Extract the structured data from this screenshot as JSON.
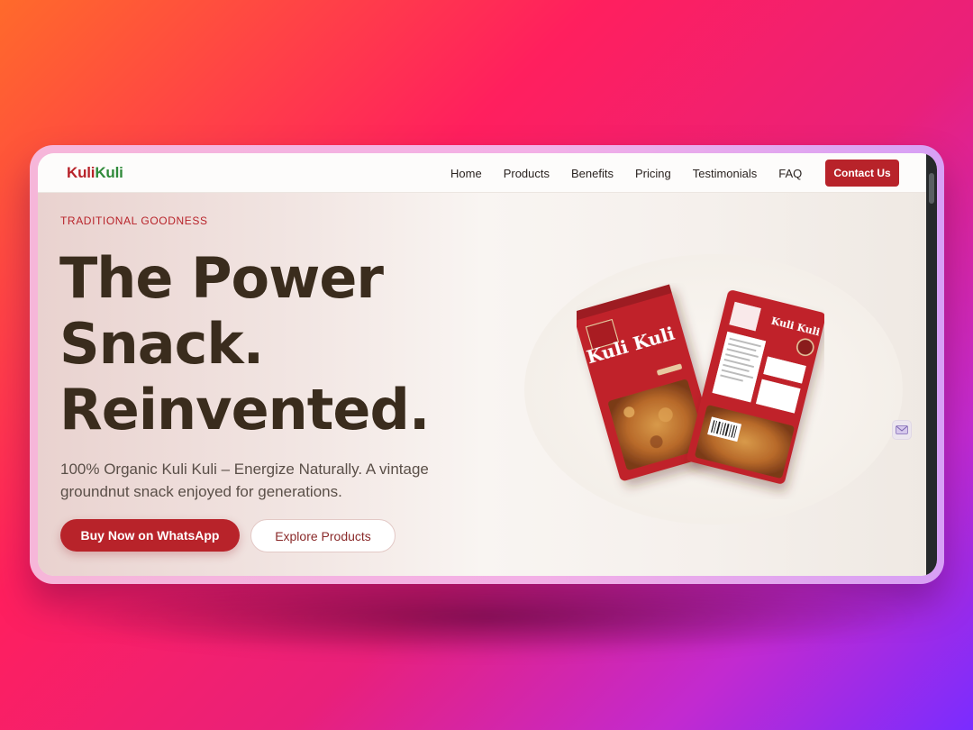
{
  "brand": {
    "part1": "Kuli",
    "part2": "Kuli"
  },
  "nav": {
    "items": [
      {
        "label": "Home"
      },
      {
        "label": "Products"
      },
      {
        "label": "Benefits"
      },
      {
        "label": "Pricing"
      },
      {
        "label": "Testimonials"
      },
      {
        "label": "FAQ"
      }
    ],
    "cta_label": "Contact Us"
  },
  "hero": {
    "eyebrow": "TRADITIONAL GOODNESS",
    "headline_lines": [
      "The Power",
      "Snack.",
      "Reinvented."
    ],
    "subtitle": "100% Organic Kuli Kuli – Energize Naturally. A vintage groundnut snack enjoyed for generations.",
    "primary_button": "Buy Now on WhatsApp",
    "secondary_button": "Explore Products"
  },
  "product_image": {
    "front_label": "Kuli Kuli",
    "back_label": "Kuli Kuli"
  },
  "colors": {
    "brand_red": "#b8232a",
    "brand_green": "#2f8a3a",
    "headline": "#3a2c1d"
  },
  "icons": {
    "side_chip": "email-icon"
  }
}
